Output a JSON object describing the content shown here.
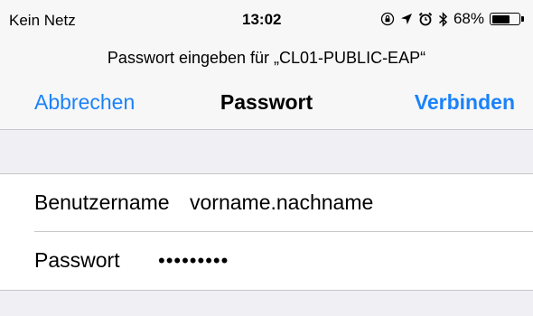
{
  "status_bar": {
    "carrier": "Kein Netz",
    "time": "13:02",
    "battery_percent": "68%",
    "battery_level": 0.68,
    "icons": [
      "rotation-lock-icon",
      "location-arrow-icon",
      "alarm-icon",
      "bluetooth-icon",
      "battery-icon"
    ]
  },
  "dialog": {
    "prompt": "Passwort eingeben für „CL01-PUBLIC-EAP“",
    "title": "Passwort",
    "cancel_label": "Abbrechen",
    "connect_label": "Verbinden"
  },
  "form": {
    "username_label": "Benutzername",
    "username_value": "vorname.nachname",
    "password_label": "Passwort",
    "password_value": "•••••••••"
  },
  "colors": {
    "accent": "#1a82fb",
    "navbar_bg": "#f7f7f7",
    "group_bg": "#efeff4",
    "separator": "#c8c7cc"
  }
}
